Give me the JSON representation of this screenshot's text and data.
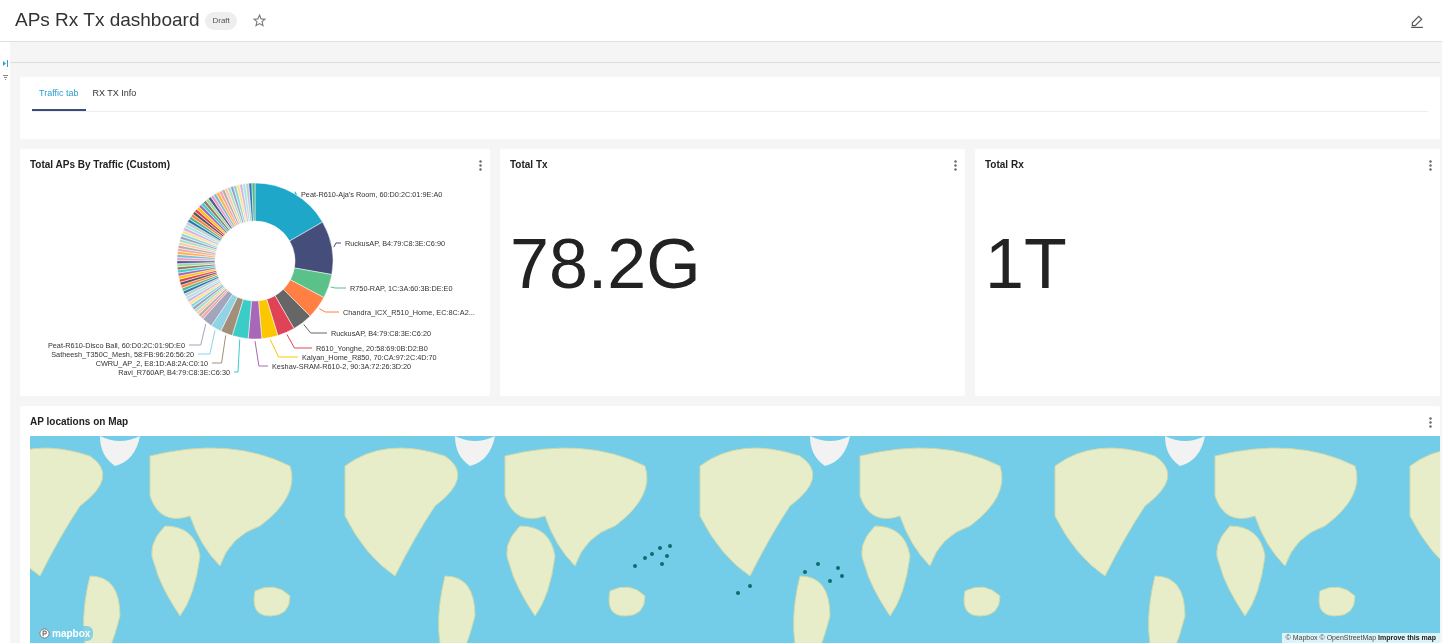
{
  "header": {
    "title": "APs Rx Tx dashboard",
    "status_badge": "Draft"
  },
  "tabs": [
    {
      "label": "Traffic tab",
      "selected": true
    },
    {
      "label": "RX TX Info",
      "selected": false
    }
  ],
  "pie_panel": {
    "title": "Total APs By Traffic (Custom)",
    "slice_labels": [
      {
        "text": "Peat-R610-Aja's Room, 60:D0:2C:01:9E:A0",
        "color": "#1fa7c9"
      },
      {
        "text": "RuckusAP, B4:79:C8:3E:C6:90",
        "color": "#454d7a"
      },
      {
        "text": "R750-RAP, 1C:3A:60:3B:DE:E0",
        "color": "#5ac189"
      },
      {
        "text": "Chandra_ICX_R510_Home, EC:8C:A2...",
        "color": "#ff7f44"
      },
      {
        "text": "RuckusAP, B4:79:C8:3E:C6:20",
        "color": "#666666"
      },
      {
        "text": "R610_Yonghe, 20:58:69:0B:D2:B0",
        "color": "#e04355"
      },
      {
        "text": "Kalyan_Home_R850, 70:CA:97:2C:4D:70",
        "color": "#fcc700"
      },
      {
        "text": "Keshav-SRAM-R610-2, 90:3A:72:26:3D:20",
        "color": "#a868b7"
      },
      {
        "text": "Peat-R610-Disco Ball, 60:D0:2C:01:9D:E0",
        "color": "#a1a6bd"
      },
      {
        "text": "Satheesh_T350C_Mesh, 58:FB:96:26:56:20",
        "color": "#8fd3e4"
      },
      {
        "text": "CWRU_AP_2, E8:1D:A8:2A:C0:10",
        "color": "#a38f79"
      },
      {
        "text": "Ravi_R760AP, B4:79:C8:3E:C6:30",
        "color": "#3cccc8"
      }
    ]
  },
  "tx_panel": {
    "title": "Total Tx",
    "value": "78.2G"
  },
  "rx_panel": {
    "title": "Total Rx",
    "value": "1T"
  },
  "map_panel": {
    "title": "AP locations on Map",
    "logo": "mapbox",
    "attribution": "© Mapbox © OpenStreetMap",
    "improve_link": "Improve this map"
  }
}
